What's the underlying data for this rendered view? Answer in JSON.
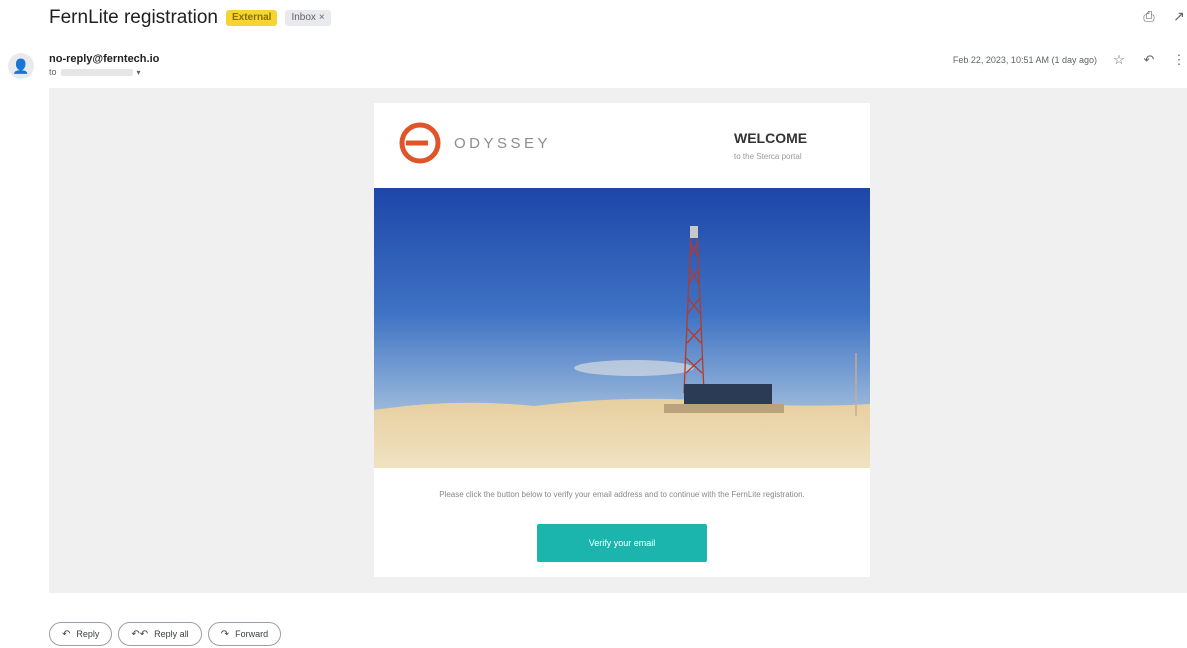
{
  "email": {
    "subject": "FernLite registration",
    "badge_external": "External",
    "badge_inbox": "Inbox",
    "badge_inbox_close": "×",
    "sender": "no-reply@ferntech.io",
    "to_prefix": "to",
    "date": "Feb 22, 2023, 10:51 AM (1 day ago)"
  },
  "icons": {
    "print": "⎙",
    "open_new": "↗",
    "star": "☆",
    "reply": "↶",
    "more": "⋮",
    "avatar": "👤",
    "caret": "▾"
  },
  "card": {
    "logo_text": "ODYSSEY",
    "welcome_title": "WELCOME",
    "welcome_subtitle": "to the Sterca portal",
    "body_text": "Please click the button below to verify your email address and to continue with the FernLite registration.",
    "button_label": "Verify your email",
    "colors": {
      "accent": "#1cb5ad",
      "logo": "#e0542a"
    }
  },
  "actions": [
    {
      "label": "Reply",
      "icon": "↶"
    },
    {
      "label": "Reply all",
      "icon": "↶↶"
    },
    {
      "label": "Forward",
      "icon": "↷"
    }
  ]
}
